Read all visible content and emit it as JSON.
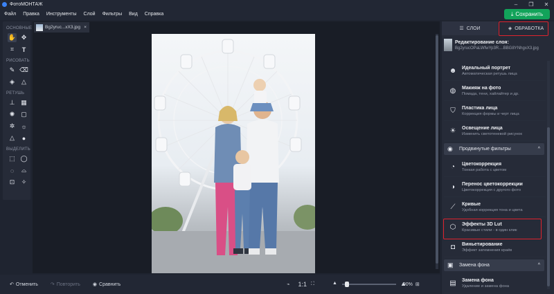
{
  "app": {
    "title": "ФотоМОНТАЖ"
  },
  "menu": [
    "Файл",
    "Правка",
    "Инструменты",
    "Слой",
    "Фильтры",
    "Вид",
    "Справка"
  ],
  "save_label": "Сохранить",
  "toolbox": {
    "sections": [
      "ОСНОВНЫЕ",
      "РИСОВАТЬ",
      "РЕТУШЬ",
      "ВЫДЕЛИТЬ"
    ]
  },
  "document_tab": {
    "name": "Bg2yruc...xX3.jpg",
    "close": "×"
  },
  "bottom": {
    "undo": "Отменить",
    "redo": "Повторить",
    "compare": "Сравнить",
    "ratio": "1:1",
    "zoom": "90%",
    "zoom_fraction": 0.05
  },
  "right_panel": {
    "tabs": [
      {
        "label": "СЛОИ",
        "icon": "sliders-icon"
      },
      {
        "label": "ОБРАБОТКА",
        "icon": "layers-icon"
      }
    ],
    "layer_edit": {
      "title": "Редактирование слоя:",
      "file": "Bg2yrucOPaLWfwYp3R....BBG8YNhgxX3.jpg"
    },
    "items_a": [
      {
        "name": "Идеальный портрет",
        "desc": "Автоматическая ретушь лица",
        "icon": "portrait-icon"
      },
      {
        "name": "Макияж на фото",
        "desc": "Помада, тени, хайлайтер и др.",
        "icon": "makeup-icon"
      },
      {
        "name": "Пластика лица",
        "desc": "Коррекция формы и черт лица",
        "icon": "shield-face-icon"
      },
      {
        "name": "Освещение лица",
        "desc": "Изменить светотеневой рисунок",
        "icon": "light-icon"
      }
    ],
    "group_advanced": {
      "label": "Продвинутые фильтры",
      "chevron": "^"
    },
    "items_b": [
      {
        "name": "Цветокоррекция",
        "desc": "Тонкая работа с цветом",
        "icon": "color-icon"
      },
      {
        "name": "Перенос цветокоррекции",
        "desc": "Цветокоррекция с другого фото",
        "icon": "transfer-icon"
      },
      {
        "name": "Кривые",
        "desc": "Удобная коррекция тона и цвета",
        "icon": "curves-icon"
      },
      {
        "name": "Эффекты 3D Lut",
        "desc": "Красивые стили - в один клик",
        "icon": "lut-cube-icon"
      },
      {
        "name": "Виньетирование",
        "desc": "Эффект затемнения краёв",
        "icon": "vignette-icon"
      }
    ],
    "group_bg": {
      "label": "Замена фона",
      "chevron": "^"
    },
    "items_c": [
      {
        "name": "Замена фона",
        "desc": "Удаление и замена фона",
        "icon": "bg-icon"
      }
    ]
  }
}
